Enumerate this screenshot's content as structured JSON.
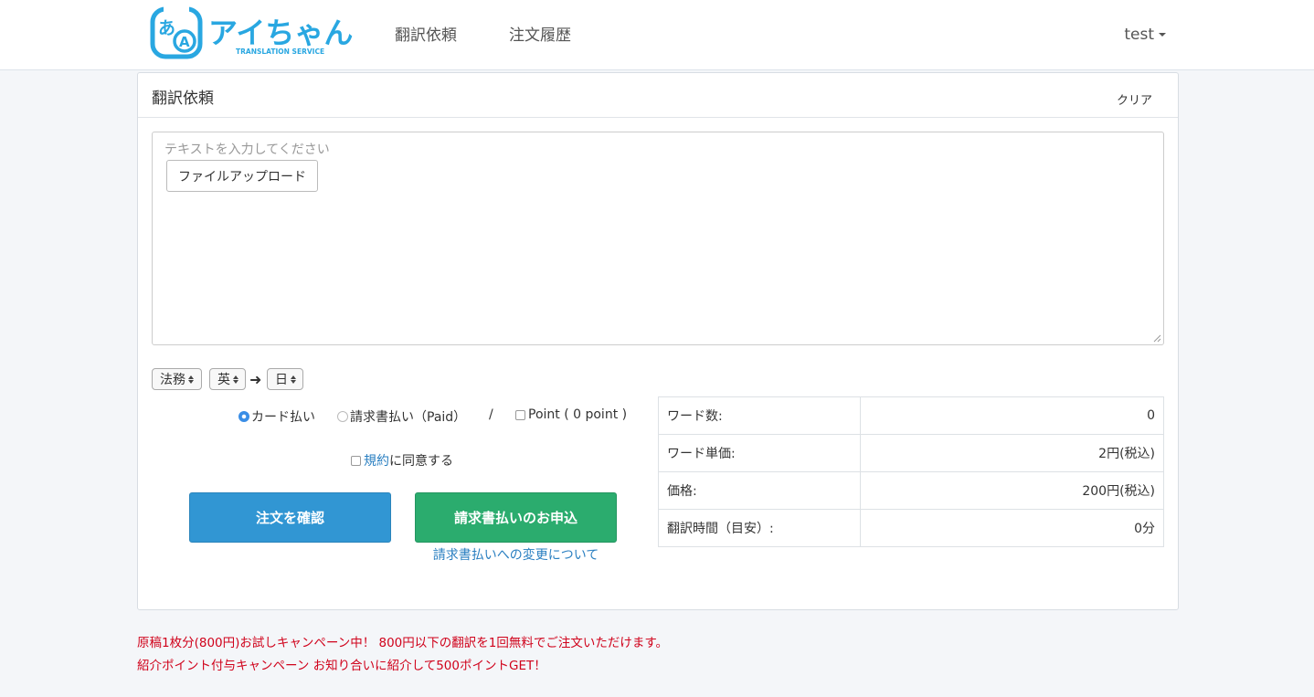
{
  "header": {
    "logo": {
      "icon_letters": [
        "あ",
        "A"
      ],
      "brand": "アイちゃん",
      "tagline": "TRANSLATION SERVICE"
    },
    "nav": [
      {
        "label": "翻訳依頼"
      },
      {
        "label": "注文履歴"
      }
    ],
    "user": "test"
  },
  "panel": {
    "title": "翻訳依頼",
    "clear_label": "クリア",
    "text_placeholder": "テキストを入力してください",
    "upload_label": "ファイルアップロード",
    "selects": {
      "category": "法務",
      "source_lang": "英",
      "target_lang": "日"
    },
    "payment": {
      "card": "カード払い",
      "invoice": "請求書払い（Paid）",
      "separator": "/",
      "point": "Point ( 0 point )"
    },
    "terms": {
      "link": "規約",
      "suffix": "に同意する"
    },
    "confirm_button": "注文を確認",
    "invoice_button": "請求書払いのお申込",
    "invoice_link": "請求書払いへの変更について",
    "summary": [
      {
        "label": "ワード数:",
        "value": "0"
      },
      {
        "label": "ワード単価:",
        "value": "2円(税込)"
      },
      {
        "label": "価格:",
        "value": "200円(税込)"
      },
      {
        "label": "翻訳時間（目安）:",
        "value": "0分"
      }
    ]
  },
  "campaigns": [
    "原稿1枚分(800円)お試しキャンペーン中！ 800円以下の翻訳を1回無料でご注文いただけます。",
    "紹介ポイント付与キャンペーン お知り合いに紹介して500ポイントGET！"
  ],
  "colors": {
    "accent_blue": "#3196d3",
    "accent_green": "#2bac6e",
    "brand_blue": "#29a7e1",
    "campaign_red": "#d0021b"
  }
}
